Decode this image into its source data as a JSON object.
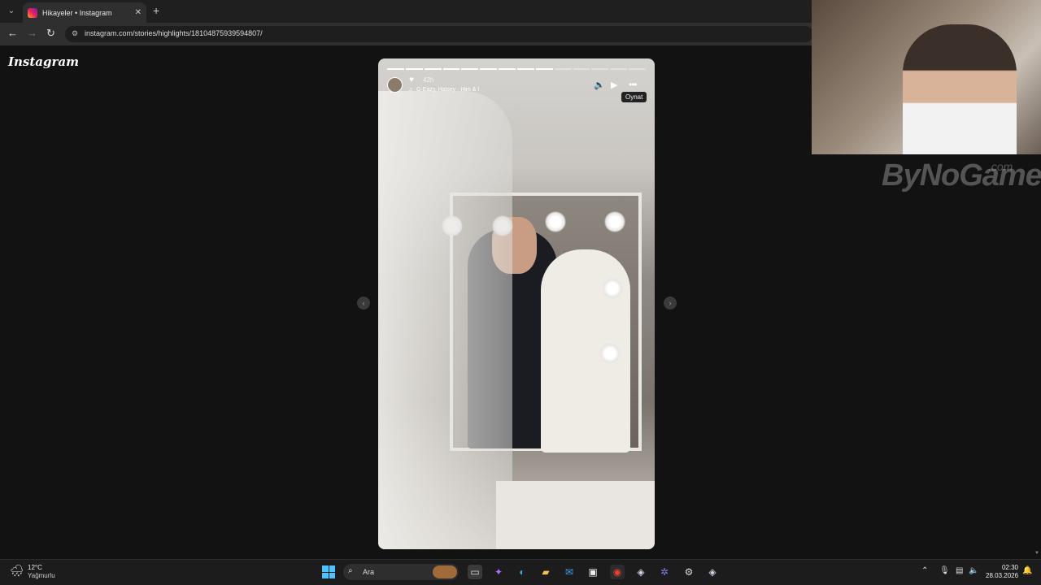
{
  "browser": {
    "tab_title": "Hikayeler • Instagram",
    "url": "instagram.com/stories/highlights/18104875939594807/"
  },
  "instagram": {
    "logo": "Instagram"
  },
  "story": {
    "age": "42h",
    "music": "G-Eazy, Halsey · Him & I",
    "tooltip": "Oynat",
    "progress_segments": 14,
    "progress_done": 9
  },
  "overlay": {
    "watermark": "ByNoGame",
    "watermark_suffix": ".com"
  },
  "taskbar": {
    "temperature": "12°C",
    "weather": "Yağmurlu",
    "search_placeholder": "Ara",
    "time": "02:30",
    "date": "28.03.2026"
  },
  "icons": {
    "accent": "#4cc2ff"
  }
}
